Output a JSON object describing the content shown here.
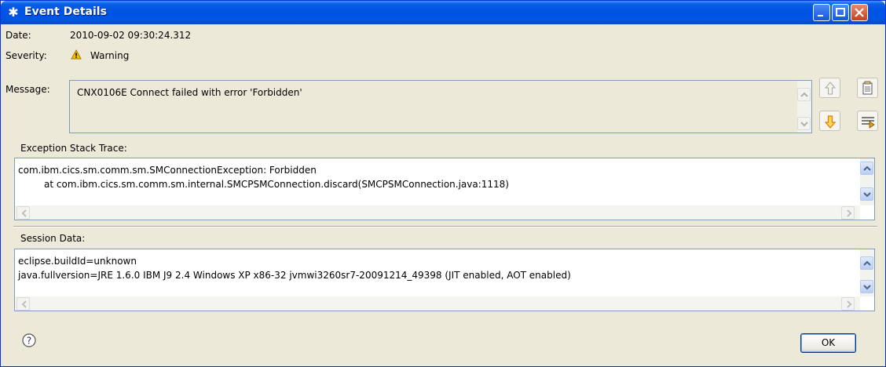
{
  "window": {
    "title": "Event Details"
  },
  "fields": {
    "date_label": "Date:",
    "date_value": "2010-09-02 09:30:24.312",
    "severity_label": "Severity:",
    "severity_value": "Warning",
    "message_label": "Message:",
    "message_value": "CNX0106E Connect failed with error 'Forbidden'"
  },
  "exception": {
    "label": "Exception Stack Trace:",
    "lines": [
      "com.ibm.cics.sm.comm.sm.SMConnectionException: Forbidden",
      "at com.ibm.cics.sm.comm.sm.internal.SMCPSMConnection.discard(SMCPSMConnection.java:1118)"
    ]
  },
  "session": {
    "label": "Session Data:",
    "lines": [
      "eclipse.buildId=unknown",
      "java.fullversion=JRE 1.6.0 IBM J9 2.4 Windows XP x86-32 jvmwi3260sr7-20091214_49398 (JIT enabled, AOT enabled)"
    ]
  },
  "buttons": {
    "ok_label": "OK"
  },
  "icons": {
    "title": "event-star-icon",
    "severity": "warning-icon",
    "help": "help-icon",
    "prev": "arrow-up-icon",
    "next": "arrow-down-icon",
    "copy": "copy-icon",
    "filter": "filter-icon"
  },
  "colors": {
    "titlebar": "#0054e3",
    "window_bg": "#ece9d8",
    "warning": "#f2c200",
    "next_arrow": "#e8a000"
  }
}
